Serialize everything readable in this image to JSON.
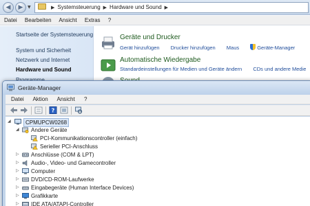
{
  "control_panel": {
    "breadcrumb": [
      "Systemsteuerung",
      "Hardware und Sound"
    ],
    "menu": [
      "Datei",
      "Bearbeiten",
      "Ansicht",
      "Extras",
      "?"
    ],
    "sidebar": {
      "home": "Startseite der Systemsteuerung",
      "items": [
        "System und Sicherheit",
        "Netzwerk und Internet",
        "Hardware und Sound",
        "Programme"
      ],
      "selected": "Hardware und Sound"
    },
    "categories": [
      {
        "title": "Geräte und Drucker",
        "links": [
          "Gerät hinzufügen",
          "Drucker hinzufügen",
          "Maus",
          "Geräte-Manager"
        ],
        "icon": "devices-printers-icon"
      },
      {
        "title": "Automatische Wiedergabe",
        "links": [
          "Standardeinstellungen für Medien und Geräte ändern",
          "CDs und andere Medie"
        ],
        "icon": "autoplay-icon"
      },
      {
        "title": "Sound",
        "links": [],
        "icon": "sound-icon"
      }
    ]
  },
  "device_manager": {
    "title": "Geräte-Manager",
    "menu": [
      "Datei",
      "Aktion",
      "Ansicht",
      "?"
    ],
    "toolbar_icons": [
      "back-arrow-icon",
      "forward-arrow-icon",
      "properties-icon",
      "help-icon",
      "view-icon",
      "scan-hardware-icon"
    ],
    "tree": {
      "root": "CPMUPCW0268",
      "other_devices": {
        "label": "Andere Geräte",
        "children": [
          "PCI-Kommunikationscontroller (einfach)",
          "Serieller PCI-Anschluss"
        ]
      },
      "categories": [
        "Anschlüsse (COM & LPT)",
        "Audio-, Video- und Gamecontroller",
        "Computer",
        "DVD/CD-ROM-Laufwerke",
        "Eingabegeräte (Human Interface Devices)",
        "Grafikkarte",
        "IDE ATA/ATAPI-Controller"
      ]
    },
    "colors": {
      "titlebar": "#c3d5ea",
      "selection": "#d9e6f6",
      "warning": "#f3c12a"
    }
  }
}
